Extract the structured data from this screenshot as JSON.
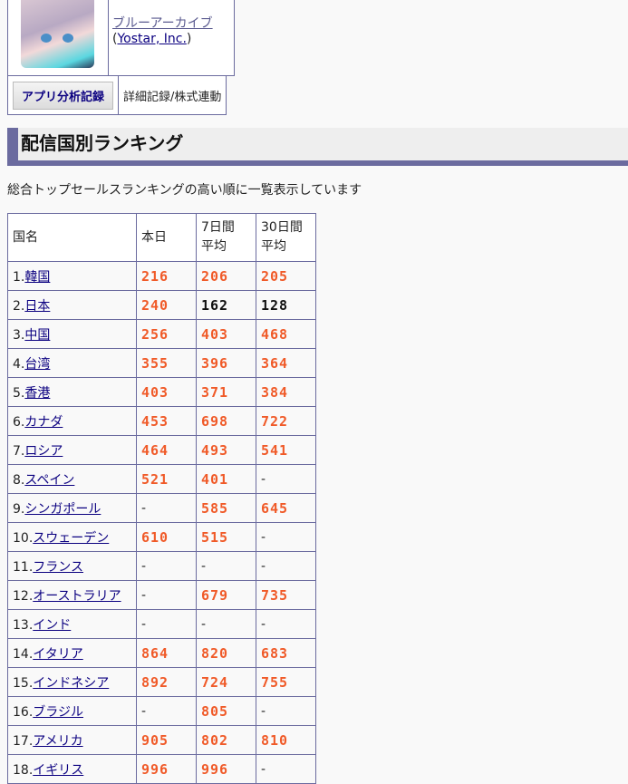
{
  "app": {
    "title": "ブルーアーカイブ",
    "publisher": "Yostar, Inc.",
    "analysis_button": "アプリ分析記録",
    "detail_label": "詳細記録/株式連動"
  },
  "section": {
    "heading": "配信国別ランキング",
    "description": "総合トップセールスランキングの高い順に一覧表示しています"
  },
  "colors": {
    "rank_highlight": "#f05a28",
    "border": "#6b6b9f"
  },
  "table": {
    "headers": {
      "country": "国名",
      "today": "本日",
      "avg7_a": "7日間",
      "avg7_b": "平均",
      "avg30_a": "30日間",
      "avg30_b": "平均"
    },
    "rows": [
      {
        "no": "1.",
        "country": "韓国",
        "cells": [
          {
            "v": "216",
            "hl": true
          },
          {
            "v": "206",
            "hl": true
          },
          {
            "v": "205",
            "hl": true
          }
        ]
      },
      {
        "no": "2.",
        "country": "日本",
        "cells": [
          {
            "v": "240",
            "hl": true
          },
          {
            "v": "162",
            "hl": false
          },
          {
            "v": "128",
            "hl": false
          }
        ]
      },
      {
        "no": "3.",
        "country": "中国",
        "cells": [
          {
            "v": "256",
            "hl": true
          },
          {
            "v": "403",
            "hl": true
          },
          {
            "v": "468",
            "hl": true
          }
        ]
      },
      {
        "no": "4.",
        "country": "台湾",
        "cells": [
          {
            "v": "355",
            "hl": true
          },
          {
            "v": "396",
            "hl": true
          },
          {
            "v": "364",
            "hl": true
          }
        ]
      },
      {
        "no": "5.",
        "country": "香港",
        "cells": [
          {
            "v": "403",
            "hl": true
          },
          {
            "v": "371",
            "hl": true
          },
          {
            "v": "384",
            "hl": true
          }
        ]
      },
      {
        "no": "6.",
        "country": "カナダ",
        "cells": [
          {
            "v": "453",
            "hl": true
          },
          {
            "v": "698",
            "hl": true
          },
          {
            "v": "722",
            "hl": true
          }
        ]
      },
      {
        "no": "7.",
        "country": "ロシア",
        "cells": [
          {
            "v": "464",
            "hl": true
          },
          {
            "v": "493",
            "hl": true
          },
          {
            "v": "541",
            "hl": true
          }
        ]
      },
      {
        "no": "8.",
        "country": "スペイン",
        "cells": [
          {
            "v": "521",
            "hl": true
          },
          {
            "v": "401",
            "hl": true
          },
          {
            "v": "-",
            "hl": false
          }
        ]
      },
      {
        "no": "9.",
        "country": "シンガポール",
        "cells": [
          {
            "v": "-",
            "hl": false
          },
          {
            "v": "585",
            "hl": true
          },
          {
            "v": "645",
            "hl": true
          }
        ]
      },
      {
        "no": "10.",
        "country": "スウェーデン",
        "cells": [
          {
            "v": "610",
            "hl": true
          },
          {
            "v": "515",
            "hl": true
          },
          {
            "v": "-",
            "hl": false
          }
        ]
      },
      {
        "no": "11.",
        "country": "フランス",
        "cells": [
          {
            "v": "-",
            "hl": false
          },
          {
            "v": "-",
            "hl": false
          },
          {
            "v": "-",
            "hl": false
          }
        ]
      },
      {
        "no": "12.",
        "country": "オーストラリア",
        "cells": [
          {
            "v": "-",
            "hl": false
          },
          {
            "v": "679",
            "hl": true
          },
          {
            "v": "735",
            "hl": true
          }
        ]
      },
      {
        "no": "13.",
        "country": "インド",
        "cells": [
          {
            "v": "-",
            "hl": false
          },
          {
            "v": "-",
            "hl": false
          },
          {
            "v": "-",
            "hl": false
          }
        ]
      },
      {
        "no": "14.",
        "country": "イタリア",
        "cells": [
          {
            "v": "864",
            "hl": true
          },
          {
            "v": "820",
            "hl": true
          },
          {
            "v": "683",
            "hl": true
          }
        ]
      },
      {
        "no": "15.",
        "country": "インドネシア",
        "cells": [
          {
            "v": "892",
            "hl": true
          },
          {
            "v": "724",
            "hl": true
          },
          {
            "v": "755",
            "hl": true
          }
        ]
      },
      {
        "no": "16.",
        "country": "ブラジル",
        "cells": [
          {
            "v": "-",
            "hl": false
          },
          {
            "v": "805",
            "hl": true
          },
          {
            "v": "-",
            "hl": false
          }
        ]
      },
      {
        "no": "17.",
        "country": "アメリカ",
        "cells": [
          {
            "v": "905",
            "hl": true
          },
          {
            "v": "802",
            "hl": true
          },
          {
            "v": "810",
            "hl": true
          }
        ]
      },
      {
        "no": "18.",
        "country": "イギリス",
        "cells": [
          {
            "v": "996",
            "hl": true
          },
          {
            "v": "996",
            "hl": true
          },
          {
            "v": "-",
            "hl": false
          }
        ]
      }
    ]
  }
}
